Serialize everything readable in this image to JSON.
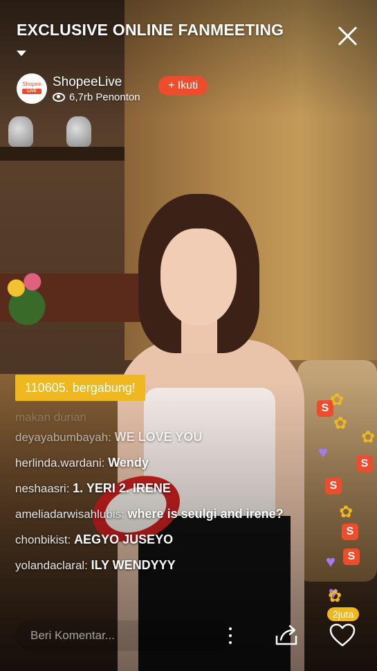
{
  "header": {
    "title": "EXCLUSIVE ONLINE FANMEETING",
    "channel_name": "ShopeeLive",
    "avatar_line1": "Shopee",
    "avatar_line2": "LIVE",
    "viewers": "6,7rb Penonton",
    "follow_label": "+ Ikuti"
  },
  "join_notice": "110605. bergabung!",
  "comments": [
    {
      "user": "makan durian",
      "message": ""
    },
    {
      "user": "deyayabumbayah:",
      "message": "WE LOVE YOU"
    },
    {
      "user": "herlinda.wardani:",
      "message": "Wendy"
    },
    {
      "user": "neshaasri:",
      "message": "1. YERI 2. IRENE"
    },
    {
      "user": "ameliadarwisahlubis:",
      "message": "where is seulgi and irene?"
    },
    {
      "user": "chonbikist:",
      "message": "AEGYO JUSEYO"
    },
    {
      "user": "yolandaclaral:",
      "message": "ILY WENDYYY"
    }
  ],
  "bottom_bar": {
    "comment_placeholder": "Beri Komentar...",
    "likes": "2juta"
  },
  "reaction_icons": [
    "s-logo-icon",
    "heart-icon",
    "flower-icon"
  ],
  "colors": {
    "accent": "#ee4d2d",
    "notice": "#f0b820"
  }
}
